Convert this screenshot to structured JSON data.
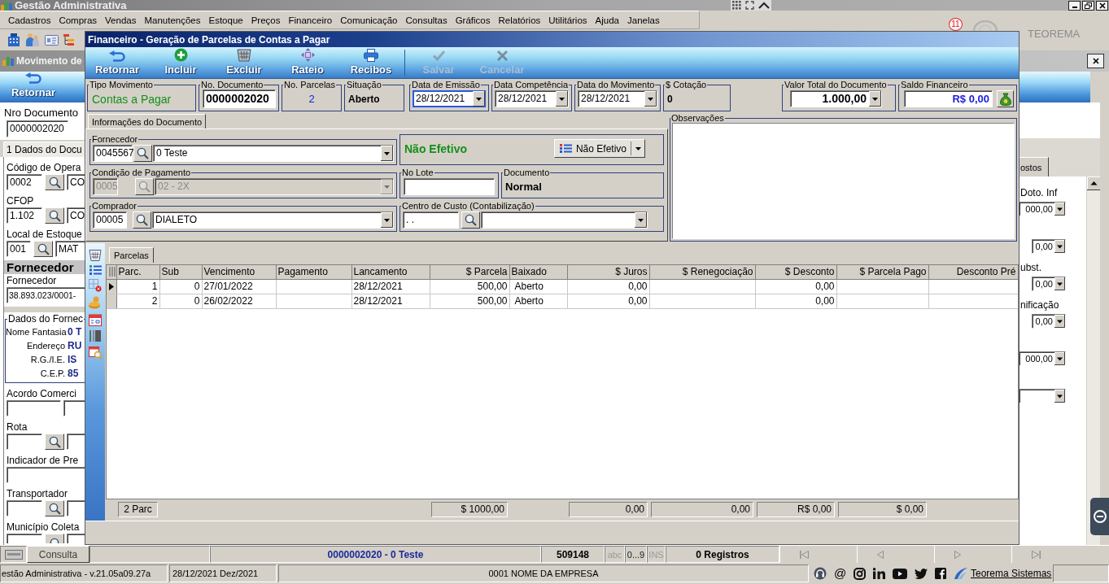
{
  "app": {
    "title": "Gestão Administrativa",
    "menu": [
      "Cadastros",
      "Compras",
      "Vendas",
      "Manutenções",
      "Estoque",
      "Preços",
      "Financeiro",
      "Comunicação",
      "Consultas",
      "Gráficos",
      "Relatórios",
      "Utilitários",
      "Ajuda",
      "Janelas"
    ],
    "notification_count": "11",
    "brand": "TEOREMA"
  },
  "movement_window": {
    "title": "Movimento de",
    "toolbar": [
      "Retornar"
    ],
    "document_label": "Nro Documento",
    "document_number": "0000002020",
    "tabs": [
      {
        "label": "1 Dados do Docu",
        "selected": true
      }
    ],
    "fields": [
      {
        "kind": "lookup",
        "label": "Código de Opera",
        "code": "0002",
        "description": "CO"
      },
      {
        "kind": "lookup",
        "label": "CFOP",
        "code": "1.102",
        "description": "CO"
      },
      {
        "kind": "lookup",
        "label": "Local de Estoque",
        "code": "001",
        "description": "MAT"
      },
      {
        "kind": "section",
        "label": "Fornecedor"
      },
      {
        "kind": "input",
        "label": "Fornecedor",
        "value": "38.893.023/0001-"
      },
      {
        "kind": "details",
        "label": "Dados do Fornec",
        "items": [
          {
            "label": "Nome Fantasia",
            "value": "0 T"
          },
          {
            "label": "Endereço",
            "value": "RU"
          },
          {
            "label": "R.G./I.E.",
            "value": "IS"
          },
          {
            "label": "C.E.P.",
            "value": "85"
          }
        ]
      },
      {
        "kind": "pair",
        "label": "Acordo Comerci"
      },
      {
        "kind": "lookup",
        "label": "Rota"
      },
      {
        "kind": "input",
        "label": "Indicador de Pre"
      },
      {
        "kind": "lookup",
        "label": "Transportador"
      },
      {
        "kind": "lookup",
        "label": "Município Coleta"
      }
    ],
    "side_tabs": [
      {
        "label": "ostos",
        "selected": false
      }
    ],
    "side_fields": [
      {
        "kind": "combo",
        "label": "Doto. Inf",
        "value": "000,00"
      },
      {
        "kind": "combo",
        "value": "0,00"
      },
      {
        "kind": "combo",
        "label": "ubst.",
        "value": "0,00"
      },
      {
        "kind": "combo",
        "label": "nificação",
        "value": "0,00"
      },
      {
        "kind": "combo",
        "value": "000,00"
      },
      {
        "kind": "combo"
      }
    ],
    "status_bar": {
      "button": "Consulta",
      "record": "0000002020 - 0 Teste",
      "code": "509148",
      "indicators": [
        {
          "label": "abc",
          "on": false
        },
        {
          "label": "0...9",
          "on": true
        },
        {
          "label": "INS",
          "on": false
        }
      ],
      "count": "0 Registros"
    }
  },
  "dialog": {
    "title": "Financeiro - Geração de Parcelas de Contas a Pagar",
    "toolbar": [
      {
        "label": "Retornar",
        "disabled": false
      },
      {
        "label": "Incluir",
        "disabled": false
      },
      {
        "label": "Excluir",
        "disabled": false
      },
      {
        "label": "Rateio",
        "disabled": false
      },
      {
        "label": "Recibos",
        "disabled": false
      },
      {
        "label": "Salvar",
        "disabled": true
      },
      {
        "label": "Cancelar",
        "disabled": true
      }
    ],
    "header": [
      {
        "kind": "status",
        "label": "Tipo Movimento",
        "value": "Contas a Pagar",
        "focused": false
      },
      {
        "kind": "input",
        "label": "No. Documento",
        "value": "0000002020",
        "focused": false
      },
      {
        "kind": "count",
        "label": "No. Parcelas",
        "value": "2",
        "focused": false
      },
      {
        "kind": "text",
        "label": "Situação",
        "value": "Aberto",
        "focused": false
      },
      {
        "kind": "date",
        "label": "Data de Emissão",
        "value": "28/12/2021",
        "focused": true
      },
      {
        "kind": "date",
        "label": "Data Competência",
        "value": "28/12/2021",
        "focused": false
      },
      {
        "kind": "date",
        "label": "Data do Movimento",
        "value": "28/12/2021",
        "focused": false
      },
      {
        "kind": "text",
        "label": "$ Cotação",
        "value": "0",
        "focused": false
      },
      {
        "kind": "amount",
        "label": "Valor Total do Documento",
        "value": "1.000,00",
        "focused": false
      },
      {
        "kind": "balance",
        "label": "Saldo Financeiro",
        "value": "R$ 0,00",
        "focused": false
      }
    ],
    "info_tabs": [
      {
        "label": "Informações do Documento",
        "selected": true
      }
    ],
    "form": [
      [
        {
          "kind": "lookup",
          "label": "Fornecedor",
          "code": "0045567",
          "value": "0 Teste",
          "disabled": false
        },
        {
          "kind": "status",
          "status": "Não Efetivo",
          "button": "Não Efetivo",
          "disabled": false
        }
      ],
      [
        {
          "kind": "lookup",
          "label": "Condição de Pagamento",
          "code": "0005",
          "value": "02 - 2X",
          "disabled": true
        },
        {
          "kind": "input",
          "label": "No Lote",
          "disabled": false
        },
        {
          "kind": "text",
          "label": "Documento",
          "value": "Normal",
          "disabled": false
        }
      ],
      [
        {
          "kind": "lookup",
          "label": "Comprador",
          "code": "00005",
          "value": "DIALETO",
          "disabled": false
        },
        {
          "kind": "lookup",
          "label": "Centro de Custo (Contabilização)",
          "code": ". .",
          "disabled": false
        }
      ]
    ],
    "observations": {
      "label": "Observações"
    },
    "grid": {
      "tabs": [
        {
          "label": "Parcelas",
          "selected": true
        }
      ],
      "columns": [
        {
          "label": "Parc.",
          "kind": "index"
        },
        {
          "label": "Sub",
          "kind": "index"
        },
        {
          "label": "Vencimento",
          "kind": "text"
        },
        {
          "label": "Pagamento",
          "kind": "text"
        },
        {
          "label": "Lancamento",
          "kind": "text"
        },
        {
          "label": "$ Parcela",
          "kind": "money"
        },
        {
          "label": "Baixado",
          "kind": "status"
        },
        {
          "label": "$ Juros",
          "kind": "money"
        },
        {
          "label": "$ Renegociação",
          "kind": "money"
        },
        {
          "label": "$ Desconto",
          "kind": "money"
        },
        {
          "label": "$ Parcela Pago",
          "kind": "money"
        },
        {
          "label": "Desconto Pré",
          "kind": "money"
        }
      ],
      "rows": [
        {
          "selected": true,
          "cells": [
            "1",
            "0",
            "27/01/2022",
            null,
            "28/12/2021",
            "500,00",
            "Aberto",
            "0,00",
            null,
            "0,00",
            null,
            null
          ]
        },
        {
          "selected": false,
          "cells": [
            "2",
            "0",
            "26/02/2022",
            null,
            "28/12/2021",
            "500,00",
            "Aberto",
            "0,00",
            null,
            "0,00",
            null,
            null
          ]
        }
      ],
      "totals": {
        "cells": [
          "2 Parc",
          null,
          null,
          null,
          null,
          "$ 1000,00",
          null,
          "0,00",
          "0,00",
          "R$ 0,00",
          "$ 0,00",
          null
        ]
      }
    }
  },
  "footer": {
    "version": "estão Administrativa - v.21.05a09.27a",
    "period": "28/12/2021 Dez/2021",
    "company": "0001 NOME DA EMPRESA",
    "email_symbol": "@",
    "link": "Teorema Sistemas"
  }
}
